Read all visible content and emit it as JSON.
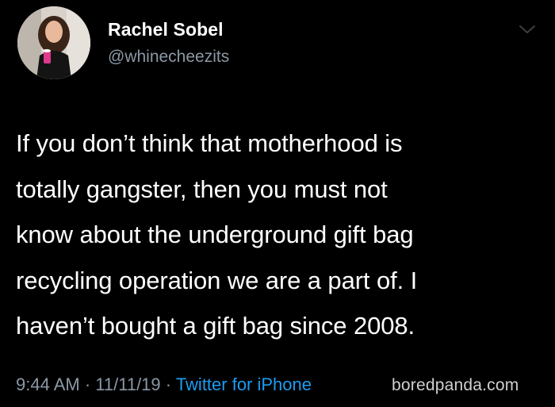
{
  "user": {
    "display_name": "Rachel Sobel",
    "handle": "@whinecheezits"
  },
  "tweet": {
    "text": "If you don’t think that motherhood is\ntotally gangster, then you must not\nknow about the underground gift bag\nrecycling operation we are a part of. I\nhaven’t bought a gift bag since 2008.",
    "time": "9:44 AM",
    "date": "11/11/19",
    "separator": " · ",
    "source": "Twitter for iPhone"
  },
  "watermark": {
    "text": "boredpanda.com"
  },
  "icons": {
    "avatar": "profile-photo",
    "menu": "chevron-down-icon"
  },
  "colors": {
    "background": "#000000",
    "text": "#ffffff",
    "secondary": "#8b98a5",
    "link": "#1d9bf0"
  }
}
